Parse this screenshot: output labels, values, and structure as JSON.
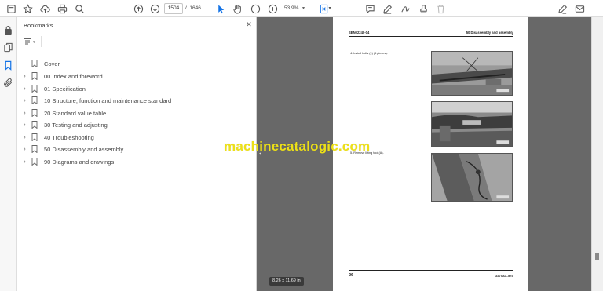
{
  "toolbar": {
    "current_page": "1504",
    "total_pages": "1646",
    "total_label": "/  1646",
    "zoom": "53,9%",
    "zoom_caret": "▾"
  },
  "bookmarks": {
    "title": "Bookmarks",
    "close_glyph": "✕",
    "items": [
      {
        "label": "Cover",
        "expandable": false
      },
      {
        "label": "00 Index and foreword",
        "expandable": true
      },
      {
        "label": "01 Specification",
        "expandable": true
      },
      {
        "label": "10 Structure, function and maintenance standard",
        "expandable": true
      },
      {
        "label": "20 Standard value table",
        "expandable": true
      },
      {
        "label": "30 Testing and adjusting",
        "expandable": true
      },
      {
        "label": "40 Troubleshooting",
        "expandable": true
      },
      {
        "label": "50 Disassembly and assembly",
        "expandable": true
      },
      {
        "label": "90 Diagrams and drawings",
        "expandable": true
      }
    ]
  },
  "document": {
    "header_code": "SEN02240-04",
    "header_section": "50 Disassembly and assembly",
    "step4": "4.    Install bolts (1) (5 pieces).",
    "step5": "5.    Remove lifting tool (A).",
    "page_number": "26",
    "model": "D275AX-5E0",
    "size_badge": "8,26 x 11,69 in"
  },
  "watermark": "machinecatalogic.com",
  "colors": {
    "accent": "#1473e6",
    "viewer_bg": "#686868",
    "watermark": "#ede017"
  }
}
